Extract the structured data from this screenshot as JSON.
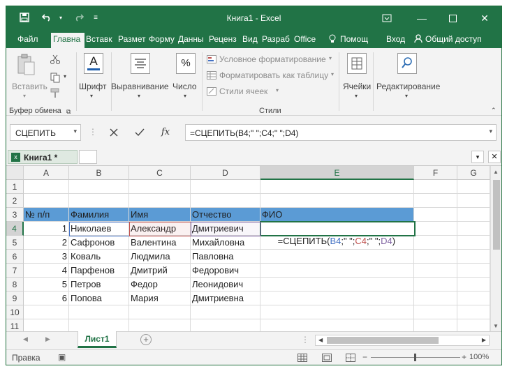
{
  "title": "Книга1 - Excel",
  "tabs": [
    "Файл",
    "Главна",
    "Вставк",
    "Размет",
    "Форму",
    "Данны",
    "Реценз",
    "Вид",
    "Разраб",
    "Office"
  ],
  "help": "Помощ",
  "signin": "Вход",
  "share": "Общий доступ",
  "ribbon": {
    "paste": "Вставить",
    "clipboard_group": "Буфер обмена",
    "font": "Шрифт",
    "alignment": "Выравнивание",
    "number": "Число",
    "percent": "%",
    "cond_format": "Условное форматирование",
    "format_table": "Форматировать как таблицу",
    "cell_styles": "Стили ячеек",
    "styles_group": "Стили",
    "cells": "Ячейки",
    "editing": "Редактирование"
  },
  "namebox": "СЦЕПИТЬ",
  "formula": "=СЦЕПИТЬ(B4;\" \";C4;\" \";D4)",
  "workbook_tab": "Книга1 *",
  "columns": [
    "A",
    "B",
    "C",
    "D",
    "E",
    "F",
    "G"
  ],
  "rows": [
    "1",
    "2",
    "3",
    "4",
    "5",
    "6",
    "7",
    "8",
    "9",
    "10",
    "11"
  ],
  "headers": {
    "a": "№ п/п",
    "b": "Фамилия",
    "c": "Имя",
    "d": "Отчество",
    "e": "ФИО"
  },
  "data": [
    {
      "n": "1",
      "f": "Николаев",
      "i": "Александр",
      "o": "Дмитриевич"
    },
    {
      "n": "2",
      "f": "Сафронов",
      "i": "Валентина",
      "o": "Михайловна"
    },
    {
      "n": "3",
      "f": "Коваль",
      "i": "Людмила",
      "o": "Павловна"
    },
    {
      "n": "4",
      "f": "Парфенов",
      "i": "Дмитрий",
      "o": "Федорович"
    },
    {
      "n": "5",
      "f": "Петров",
      "i": "Федор",
      "o": "Леонидович"
    },
    {
      "n": "6",
      "f": "Попова",
      "i": "Мария",
      "o": "Дмитриевна"
    }
  ],
  "edit_formula": {
    "p1": "=СЦЕПИТЬ(",
    "b": "B4",
    "s1": ";\" \";",
    "c": "C4",
    "s2": ";\" \";",
    "d": "D4",
    "p2": ")"
  },
  "ref_colors": {
    "b": "#4472c4",
    "c": "#c0504d",
    "d": "#8064a2"
  },
  "sheet": "Лист1",
  "status": "Правка",
  "zoom": "100%",
  "colors": {
    "accent": "#217346",
    "table_header": "#5b9bd5"
  }
}
